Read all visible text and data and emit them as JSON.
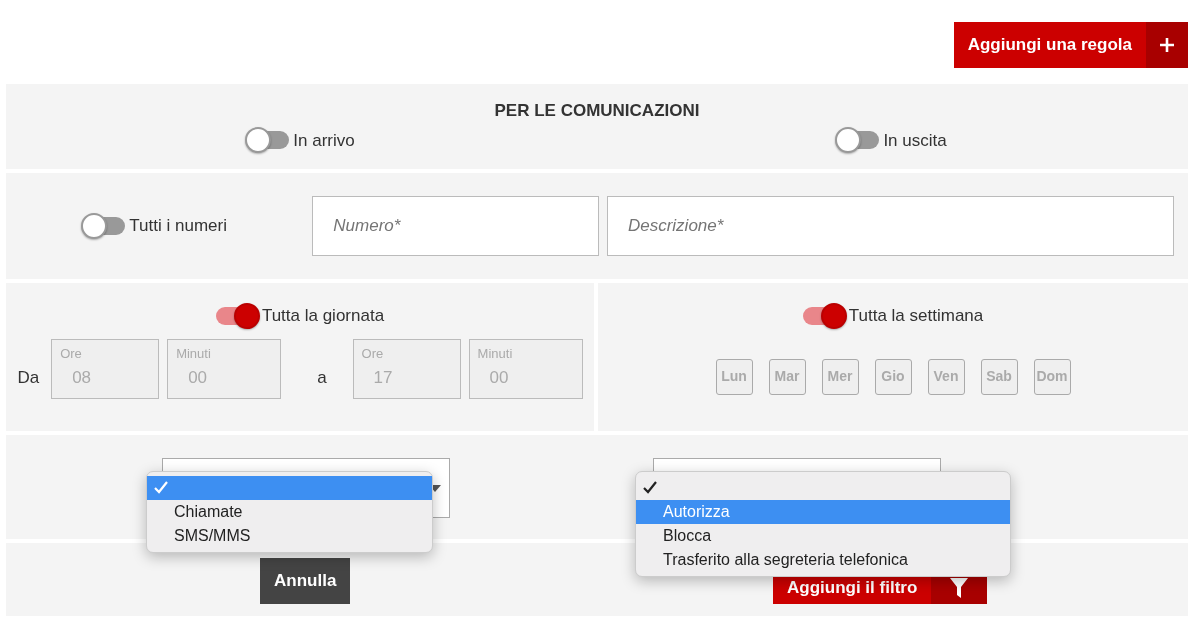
{
  "add_rule_button": {
    "label": "Aggiungi una regola"
  },
  "communications": {
    "title": "PER LE COMUNICAZIONI",
    "toggles": [
      {
        "label": "In arrivo",
        "on": false
      },
      {
        "label": "In uscita",
        "on": false
      }
    ]
  },
  "numbers": {
    "toggle": {
      "label": "Tutti i numeri",
      "on": false
    },
    "fields": [
      {
        "placeholder": "Numero*"
      },
      {
        "placeholder": "Descrizione*"
      }
    ]
  },
  "day_schedule": {
    "toggle": {
      "label": "Tutta la giornata",
      "on": true
    },
    "from_label": "Da",
    "to_label": "a",
    "fields": [
      {
        "label": "Ore",
        "value": "08",
        "disabled": true
      },
      {
        "label": "Minuti",
        "value": "00",
        "disabled": true
      },
      {
        "label": "Ore",
        "value": "17",
        "disabled": true
      },
      {
        "label": "Minuti",
        "value": "00",
        "disabled": true
      }
    ]
  },
  "week_schedule": {
    "toggle": {
      "label": "Tutta la settimana",
      "on": true
    },
    "days": [
      {
        "label": "Lun",
        "disabled": true
      },
      {
        "label": "Mar",
        "disabled": true
      },
      {
        "label": "Mer",
        "disabled": true
      },
      {
        "label": "Gio",
        "disabled": true
      },
      {
        "label": "Ven",
        "disabled": true
      },
      {
        "label": "Sab",
        "disabled": true
      },
      {
        "label": "Dom",
        "disabled": true
      }
    ]
  },
  "selects": [
    {
      "menu": [
        {
          "checked": true,
          "highlighted": true
        },
        {
          "label": "Chiamate",
          "checked": false,
          "highlighted": false
        },
        {
          "label": "SMS/MMS",
          "checked": false,
          "highlighted": false
        }
      ]
    },
    {
      "menu": [
        {
          "checked": true,
          "highlighted": false
        },
        {
          "label": "Autorizza",
          "checked": false,
          "highlighted": true
        },
        {
          "label": "Blocca",
          "checked": false,
          "highlighted": false
        },
        {
          "label": "Trasferito alla segreteria telefonica",
          "checked": false,
          "highlighted": false
        }
      ]
    }
  ],
  "actions": {
    "cancel": "Annulla",
    "add_filter": "Aggiungi il filtro"
  }
}
